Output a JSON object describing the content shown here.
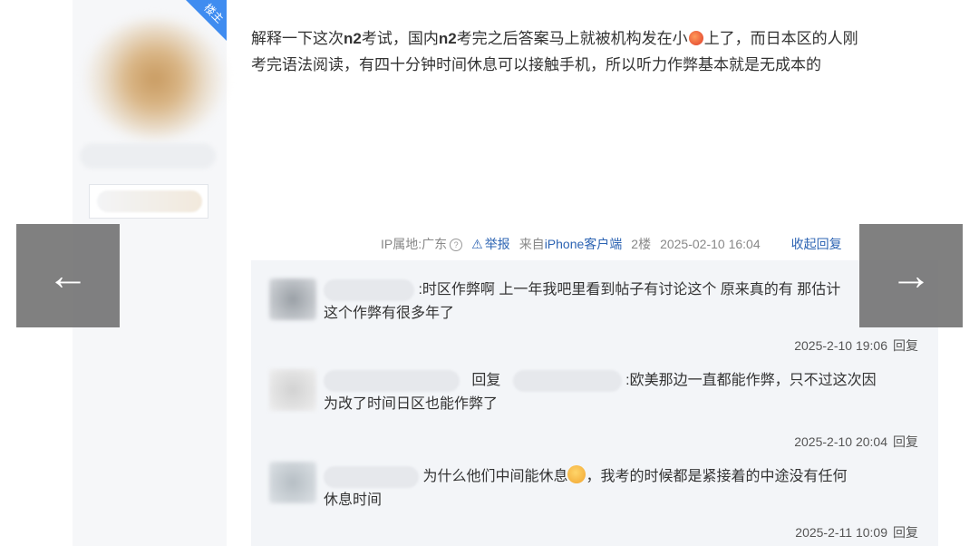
{
  "sidebar": {
    "badge": "楼主"
  },
  "post": {
    "line1_a": "解释一下这次",
    "line1_b": "n2",
    "line1_c": "考试，国内",
    "line1_d": "n2",
    "line1_e": "考完之后答案马上就被机构发在小",
    "line1_f": "上了，而日本区的人刚",
    "line2": "考完语法阅读，有四十分钟时间休息可以接触手机，所以听力作弊基本就是无成本的"
  },
  "meta": {
    "ip": "IP属地:广东",
    "report": "举报",
    "from": "来自",
    "client": "iPhone客户端",
    "floor": "2楼",
    "time": "2025-02-10 16:04",
    "collapse": "收起回复"
  },
  "comments": [
    {
      "text_line1": ":时区作弊啊 上一年我吧里看到帖子有讨论这个 原来真的有 那估计",
      "text_line2": "这个作弊有很多年了",
      "time": "2025-2-10 19:06",
      "reply": "回复"
    },
    {
      "reply_word": "回复",
      "text_line1": ":欧美那边一直都能作弊，只不过这次因",
      "text_line2": "为改了时间日区也能作弊了",
      "time": "2025-2-10 20:04",
      "reply": "回复"
    },
    {
      "text_line1a": "为什么他们中间能休息",
      "text_line1b": "，我考的时候都是紧接着的中途没有任何",
      "text_line2": "休息时间",
      "time": "2025-2-11 10:09",
      "reply": "回复"
    }
  ],
  "nav": {
    "prev": "←",
    "next": "→"
  }
}
